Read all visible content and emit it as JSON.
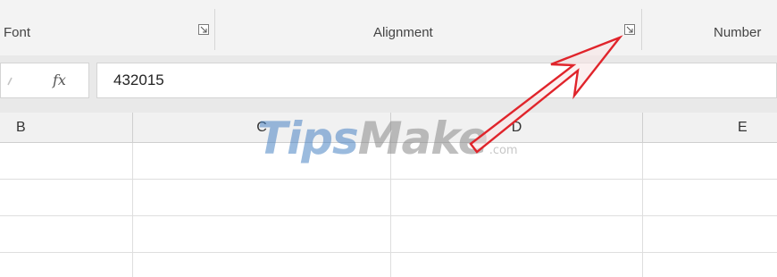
{
  "ribbon": {
    "groups": [
      {
        "label": "Font"
      },
      {
        "label": "Alignment"
      },
      {
        "label": "Number"
      }
    ]
  },
  "formula_bar": {
    "fx_label": "fx",
    "value": "432015"
  },
  "columns": [
    {
      "label": "B"
    },
    {
      "label": "C"
    },
    {
      "label": "D"
    },
    {
      "label": "E"
    }
  ],
  "watermark": {
    "part1": "Tips",
    "part2": "Make",
    "part3": ".com"
  },
  "colors": {
    "arrow": "#e0242b",
    "watermark_blue": "#4a84c4"
  }
}
